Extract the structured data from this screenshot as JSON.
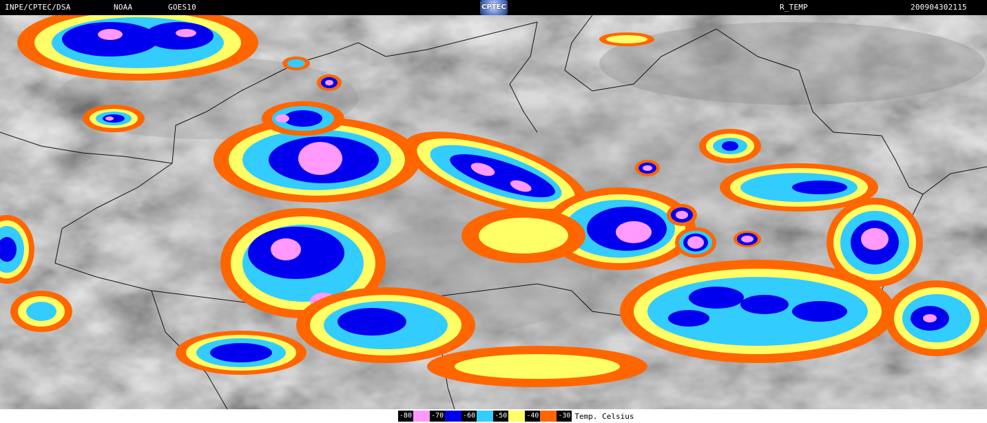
{
  "header": {
    "source": "INPE/CPTEC/DSA",
    "agency": "NOAA",
    "satellite": "GOES10",
    "logo_text": "CPTEC",
    "product": "R_TEMP",
    "timestamp": "200904302115"
  },
  "legend": {
    "items": [
      {
        "label": "-80",
        "color": "#ff99ff"
      },
      {
        "label": "-70",
        "color": "#0000ee"
      },
      {
        "label": "-60",
        "color": "#33ccff"
      },
      {
        "label": "-50",
        "color": "#ffff66"
      },
      {
        "label": "-40",
        "color": "#ff6600"
      },
      {
        "label": "-30",
        "color": ""
      }
    ],
    "unit": "Temp. Celsius"
  }
}
